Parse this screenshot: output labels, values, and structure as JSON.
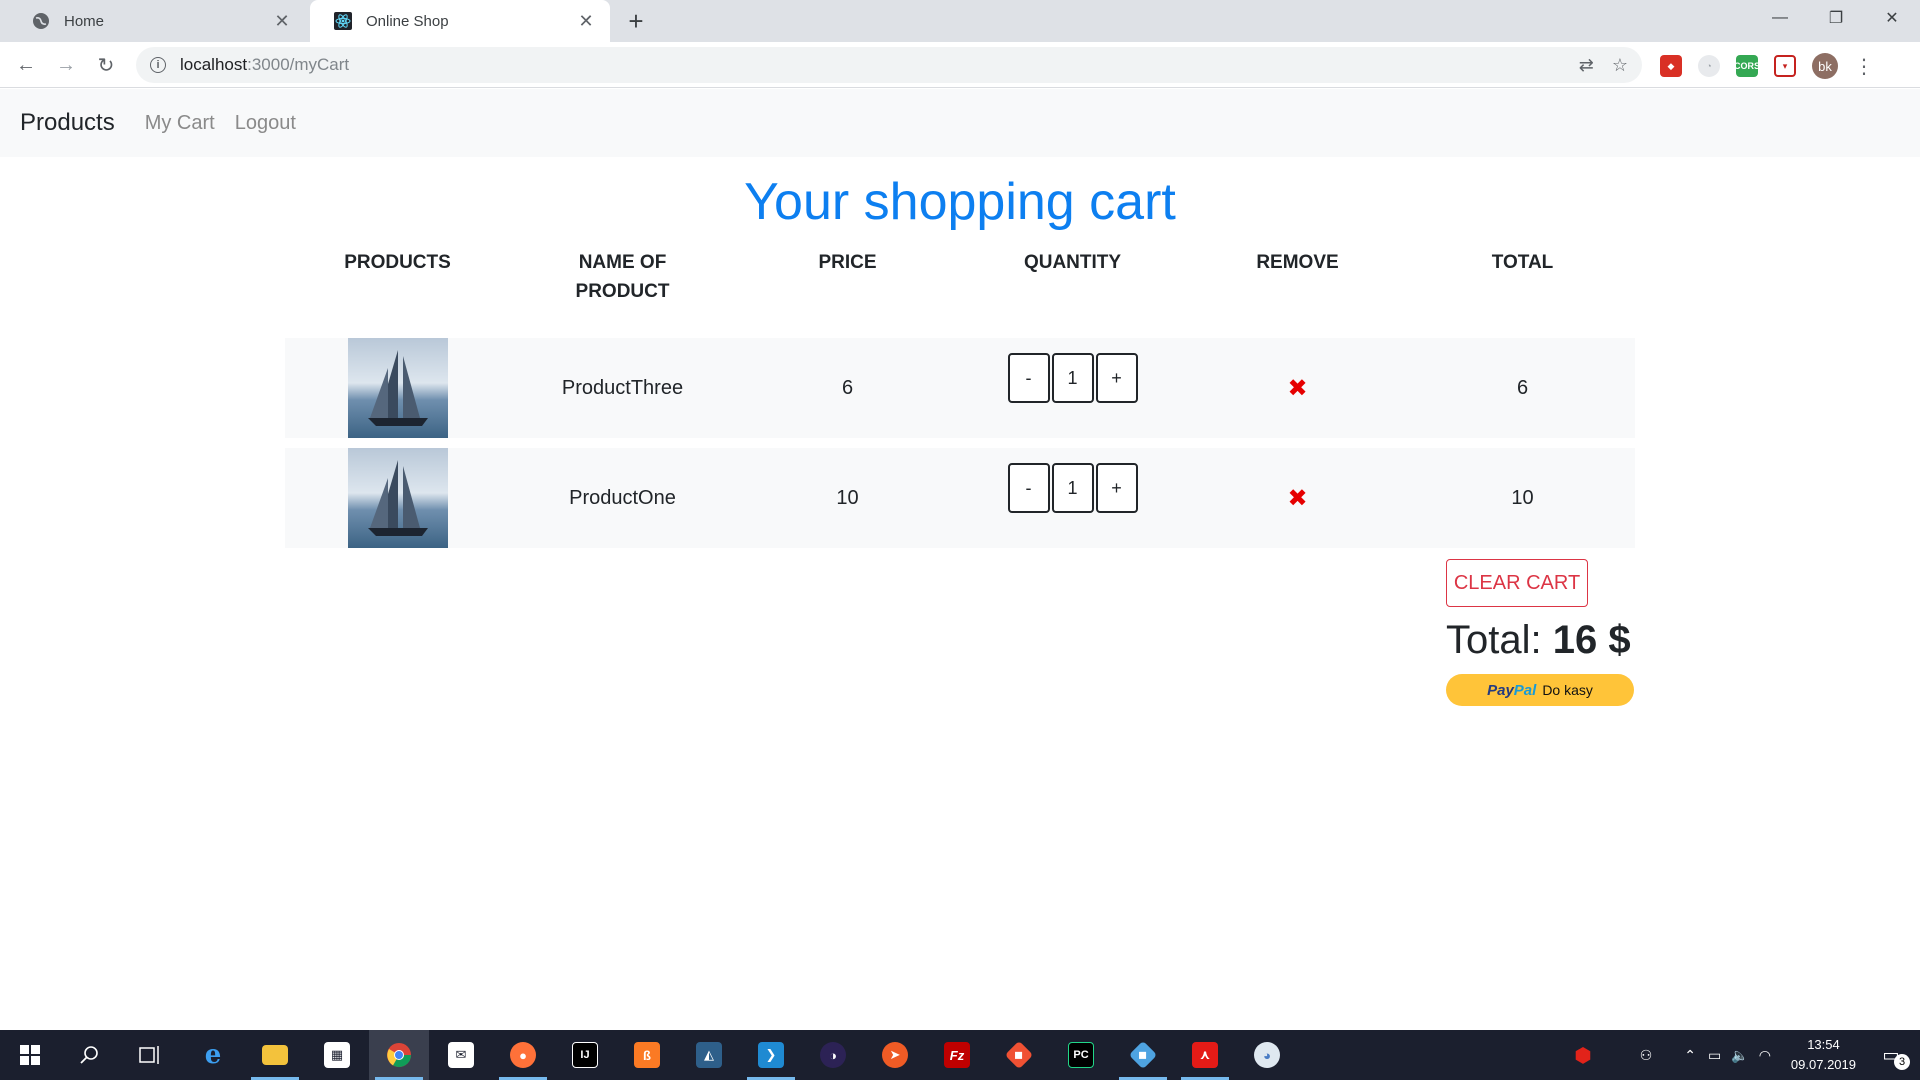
{
  "browser": {
    "tabs": [
      {
        "title": "Home",
        "icon": "globe-icon",
        "active": false
      },
      {
        "title": "Online Shop",
        "icon": "react-icon",
        "active": true
      }
    ],
    "new_tab_label": "+",
    "address": {
      "host": "localhost",
      "path": ":3000/myCart"
    },
    "profile_initials": "bk",
    "window_controls": {
      "minimize": "—",
      "maximize": "❐",
      "close": "✕"
    }
  },
  "navbar": {
    "brand": "Products",
    "links": [
      "My Cart",
      "Logout"
    ]
  },
  "page": {
    "title": "Your shopping cart"
  },
  "cart": {
    "headers": [
      "PRODUCTS",
      "NAME OF PRODUCT",
      "PRICE",
      "QUANTITY",
      "REMOVE",
      "TOTAL"
    ],
    "items": [
      {
        "name": "ProductThree",
        "price": "6",
        "quantity": "1",
        "total": "6",
        "image": "sailing-ship-image"
      },
      {
        "name": "ProductOne",
        "price": "10",
        "quantity": "1",
        "total": "10",
        "image": "sailing-ship-image"
      }
    ],
    "decrement_label": "-",
    "increment_label": "+",
    "remove_symbol": "✖",
    "clear_button": "CLEAR CART",
    "total_label": "Total:",
    "total_value": "16 $",
    "paypal": {
      "brand_a": "Pay",
      "brand_b": "Pal",
      "label": "Do kasy"
    }
  },
  "taskbar": {
    "time": "13:54",
    "date": "09.07.2019",
    "notification_count": "3"
  },
  "colors": {
    "title_blue": "#0d7ff0",
    "remove_red": "#e60000",
    "clear_red": "#dc3545",
    "paypal_yellow": "#ffc439"
  }
}
